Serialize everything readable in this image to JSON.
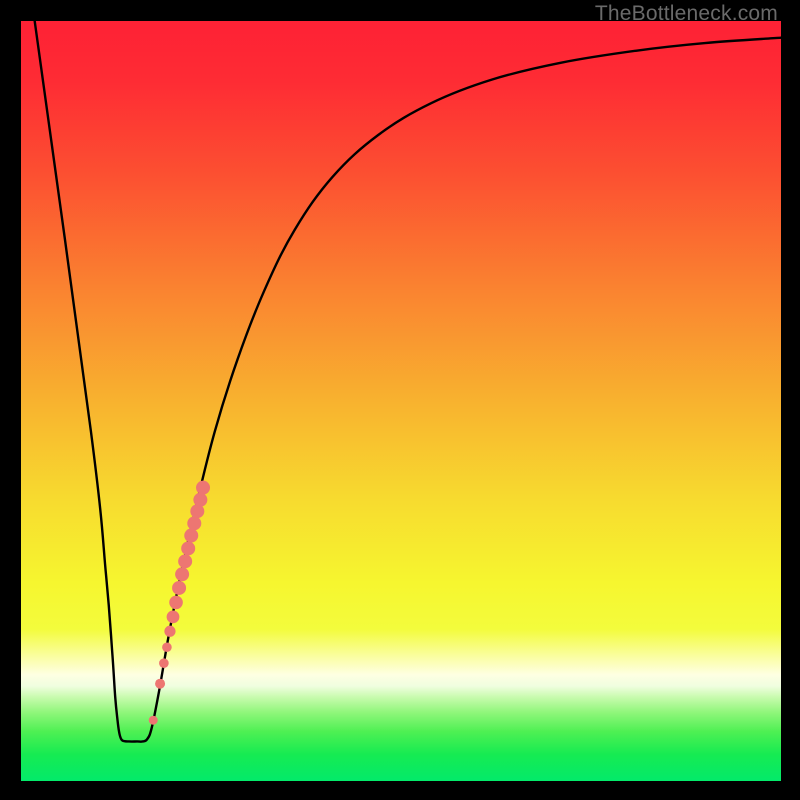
{
  "watermark": "TheBottleneck.com",
  "chart_data": {
    "type": "line",
    "title": "",
    "xlabel": "",
    "ylabel": "",
    "xlim": [
      0,
      100
    ],
    "ylim": [
      0,
      100
    ],
    "background_gradient": {
      "stops": [
        {
          "offset": 0.0,
          "color": "#fe2135"
        },
        {
          "offset": 0.08,
          "color": "#fe2c34"
        },
        {
          "offset": 0.2,
          "color": "#fc4f31"
        },
        {
          "offset": 0.35,
          "color": "#fa8230"
        },
        {
          "offset": 0.5,
          "color": "#f8b22f"
        },
        {
          "offset": 0.63,
          "color": "#f7db2f"
        },
        {
          "offset": 0.74,
          "color": "#f6f62f"
        },
        {
          "offset": 0.8,
          "color": "#f3fc3c"
        },
        {
          "offset": 0.84,
          "color": "#fbfeac"
        },
        {
          "offset": 0.86,
          "color": "#feffe2"
        },
        {
          "offset": 0.875,
          "color": "#f0fee0"
        },
        {
          "offset": 0.89,
          "color": "#c7fbad"
        },
        {
          "offset": 0.91,
          "color": "#8ff67a"
        },
        {
          "offset": 0.935,
          "color": "#4ef053"
        },
        {
          "offset": 0.965,
          "color": "#16eb52"
        },
        {
          "offset": 1.0,
          "color": "#03ea6a"
        }
      ]
    },
    "series": [
      {
        "name": "bottleneck-curve",
        "color": "#000000",
        "width": 2.4,
        "points": [
          {
            "x": 1.8,
            "y": 100.0
          },
          {
            "x": 9.2,
            "y": 46.0
          },
          {
            "x": 11.2,
            "y": 27.0
          },
          {
            "x": 12.0,
            "y": 17.0
          },
          {
            "x": 12.4,
            "y": 11.0
          },
          {
            "x": 12.7,
            "y": 8.0
          },
          {
            "x": 12.9,
            "y": 6.5
          },
          {
            "x": 13.1,
            "y": 5.7
          },
          {
            "x": 13.4,
            "y": 5.3
          },
          {
            "x": 14.2,
            "y": 5.2
          },
          {
            "x": 15.3,
            "y": 5.2
          },
          {
            "x": 16.0,
            "y": 5.2
          },
          {
            "x": 16.6,
            "y": 5.5
          },
          {
            "x": 17.2,
            "y": 7.0
          },
          {
            "x": 18.2,
            "y": 12.0
          },
          {
            "x": 19.5,
            "y": 19.5
          },
          {
            "x": 21.0,
            "y": 27.0
          },
          {
            "x": 23.0,
            "y": 36.0
          },
          {
            "x": 25.5,
            "y": 46.0
          },
          {
            "x": 28.5,
            "y": 55.5
          },
          {
            "x": 32.0,
            "y": 64.5
          },
          {
            "x": 36.0,
            "y": 72.5
          },
          {
            "x": 41.0,
            "y": 79.5
          },
          {
            "x": 47.0,
            "y": 85.0
          },
          {
            "x": 54.0,
            "y": 89.2
          },
          {
            "x": 62.0,
            "y": 92.3
          },
          {
            "x": 71.0,
            "y": 94.5
          },
          {
            "x": 81.0,
            "y": 96.1
          },
          {
            "x": 90.0,
            "y": 97.1
          },
          {
            "x": 100.0,
            "y": 97.8
          }
        ]
      }
    ],
    "scatter": {
      "name": "data-markers",
      "fill": "#ed7672",
      "stroke": "#ed7672",
      "points": [
        {
          "x": 17.4,
          "y": 8.0,
          "r": 4.5
        },
        {
          "x": 18.3,
          "y": 12.8,
          "r": 5.0
        },
        {
          "x": 18.8,
          "y": 15.5,
          "r": 4.8
        },
        {
          "x": 19.2,
          "y": 17.6,
          "r": 4.8
        },
        {
          "x": 19.6,
          "y": 19.7,
          "r": 5.6
        },
        {
          "x": 20.0,
          "y": 21.6,
          "r": 6.4
        },
        {
          "x": 20.4,
          "y": 23.5,
          "r": 6.8
        },
        {
          "x": 20.8,
          "y": 25.4,
          "r": 7.0
        },
        {
          "x": 21.2,
          "y": 27.2,
          "r": 7.0
        },
        {
          "x": 21.6,
          "y": 28.9,
          "r": 7.0
        },
        {
          "x": 22.0,
          "y": 30.6,
          "r": 7.0
        },
        {
          "x": 22.4,
          "y": 32.3,
          "r": 7.0
        },
        {
          "x": 22.8,
          "y": 33.9,
          "r": 7.0
        },
        {
          "x": 23.2,
          "y": 35.5,
          "r": 7.0
        },
        {
          "x": 23.6,
          "y": 37.0,
          "r": 7.0
        },
        {
          "x": 23.95,
          "y": 38.6,
          "r": 7.0
        }
      ]
    }
  }
}
